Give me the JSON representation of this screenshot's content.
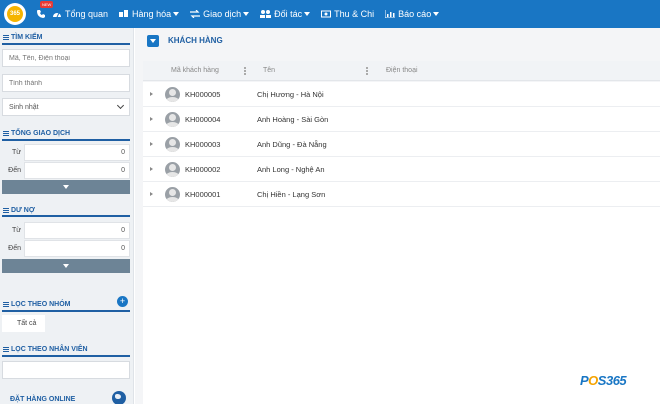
{
  "topbar": {
    "logo_text": "365",
    "phone_badge": "NEW",
    "nav": [
      {
        "label": "Tổng quan",
        "icon": "dashboard-icon",
        "dropdown": false
      },
      {
        "label": "Hàng hóa",
        "icon": "box-icon",
        "dropdown": true
      },
      {
        "label": "Giao dịch",
        "icon": "exchange-icon",
        "dropdown": true
      },
      {
        "label": "Đối tác",
        "icon": "users-icon",
        "dropdown": true
      },
      {
        "label": "Thu & Chi",
        "icon": "money-icon",
        "dropdown": false
      },
      {
        "label": "Báo cáo",
        "icon": "bar-chart-icon",
        "dropdown": true
      }
    ]
  },
  "sidebar": {
    "search": {
      "title": "TÌM KIẾM",
      "keyword_placeholder": "Mã, Tên, Điện thoại",
      "province_placeholder": "Tỉnh thành",
      "birthday_value": "Sinh nhật"
    },
    "total_transactions": {
      "title": "TỔNG GIAO DỊCH",
      "from_label": "Từ",
      "from_value": "0",
      "to_label": "Đến",
      "to_value": "0"
    },
    "debt": {
      "title": "DƯ NỢ",
      "from_label": "Từ",
      "from_value": "0",
      "to_label": "Đến",
      "to_value": "0"
    },
    "group_filter": {
      "title": "LỌC THEO NHÓM",
      "all_label": "Tất cả"
    },
    "staff_filter": {
      "title": "LỌC THEO NHÂN VIÊN"
    },
    "online_orders_label": "ĐẶT HÀNG ONLINE"
  },
  "main": {
    "panel_title": "KHÁCH HÀNG",
    "columns": [
      "Mã khách hàng",
      "Tên",
      "Điện thoại"
    ],
    "rows": [
      {
        "code": "KH000005",
        "name": "Chị Hương - Hà Nội",
        "phone": ""
      },
      {
        "code": "KH000004",
        "name": "Anh Hoàng - Sài Gòn",
        "phone": ""
      },
      {
        "code": "KH000003",
        "name": "Anh Dũng - Đà Nẵng",
        "phone": ""
      },
      {
        "code": "KH000002",
        "name": "Anh Long - Nghệ An",
        "phone": ""
      },
      {
        "code": "KH000001",
        "name": "Chị Hiền - Lạng Sơn",
        "phone": ""
      }
    ]
  },
  "brand": {
    "prefix": "P",
    "o": "O",
    "suffix": "S365"
  },
  "colors": {
    "primary": "#1976c4",
    "sidebar_accent": "#1f5fa3",
    "filter_button": "#6d8496",
    "brand_accent": "#f5a300"
  }
}
